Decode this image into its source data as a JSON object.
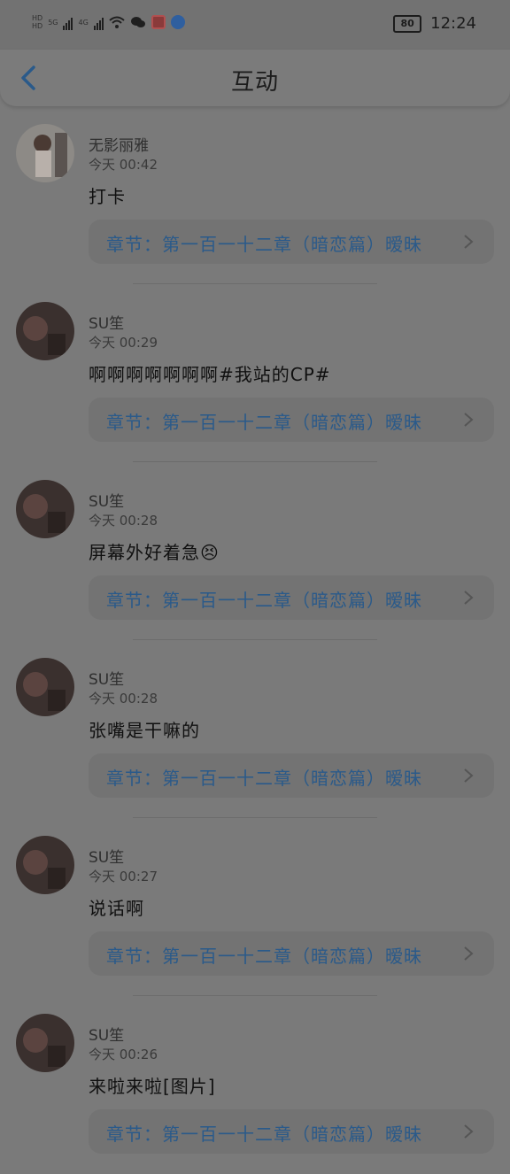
{
  "status": {
    "sim1": "HD",
    "sim2": "HD",
    "net1": "5G",
    "net2": "4G",
    "battery": "80",
    "time": "12:24"
  },
  "header": {
    "title": "互动"
  },
  "comments": [
    {
      "user": "无影丽雅",
      "time": "今天 00:42",
      "content": "打卡",
      "chapter": "章节：第一百一十二章（暗恋篇）暧昧"
    },
    {
      "user": "SU笙",
      "time": "今天 00:29",
      "content": "啊啊啊啊啊啊啊#我站的CP#",
      "chapter": "章节：第一百一十二章（暗恋篇）暧昧"
    },
    {
      "user": "SU笙",
      "time": "今天 00:28",
      "content": "屏幕外好着急😣",
      "chapter": "章节：第一百一十二章（暗恋篇）暧昧"
    },
    {
      "user": "SU笙",
      "time": "今天 00:28",
      "content": "张嘴是干嘛的",
      "chapter": "章节：第一百一十二章（暗恋篇）暧昧"
    },
    {
      "user": "SU笙",
      "time": "今天 00:27",
      "content": "说话啊",
      "chapter": "章节：第一百一十二章（暗恋篇）暧昧"
    },
    {
      "user": "SU笙",
      "time": "今天 00:26",
      "content": "来啦来啦[图片]",
      "chapter": "章节：第一百一十二章（暗恋篇）暧昧"
    }
  ]
}
